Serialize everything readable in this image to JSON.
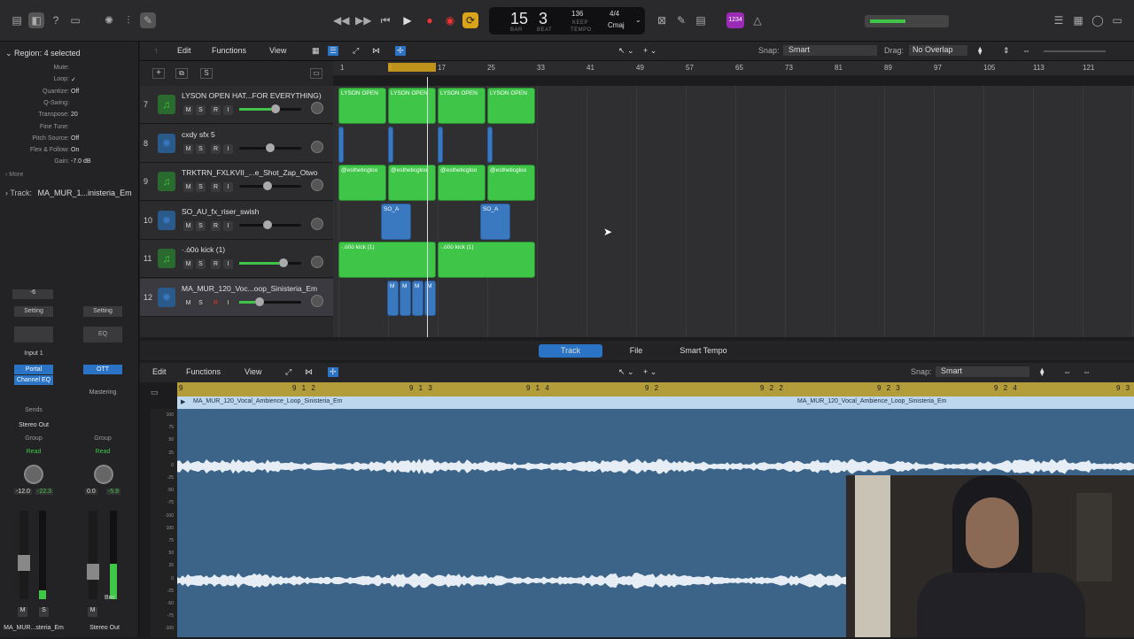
{
  "transport": {
    "bar": "15",
    "beat": "3",
    "bar_label": "BAR",
    "beat_label": "BEAT",
    "tempo": "136",
    "tempo_sub": "KEEP",
    "tempo_label": "TEMPO",
    "signature": "4/4",
    "key": "Cmaj",
    "count_in": "1234"
  },
  "inspector": {
    "region_title": "Region: 4 selected",
    "rows": [
      {
        "k": "Mute:",
        "v": ""
      },
      {
        "k": "Loop:",
        "v": "✓"
      },
      {
        "k": "Quantize:",
        "v": "Off"
      },
      {
        "k": "Q-Swing:",
        "v": ""
      },
      {
        "k": "Transpose:",
        "v": "20"
      },
      {
        "k": "Fine Tune:",
        "v": ""
      },
      {
        "k": "Pitch Source:",
        "v": "Off"
      },
      {
        "k": "Flex & Follow:",
        "v": "On"
      },
      {
        "k": "Gain:",
        "v": "-7.0 dB"
      }
    ],
    "more": "More",
    "track_label": "Track:",
    "track_name": "MA_MUR_1...inisteria_Em",
    "ch1": {
      "value": "-6",
      "setting": "Setting",
      "input": "Input 1",
      "plugin1": "Portal",
      "plugin2": "Channel EQ",
      "sends": "Sends",
      "out": "Stereo Out",
      "group": "Group",
      "read": "Read",
      "pan_l": "-12.0",
      "pan_r": "-22.3",
      "m": "M",
      "s": "S",
      "name": "MA_MUR...steria_Em"
    },
    "ch2": {
      "setting": "Setting",
      "eq": "EQ",
      "plugin1": "OTT",
      "plugin2": "Mastering",
      "group": "Group",
      "read": "Read",
      "pan_l": "0.0",
      "pan_r": "-5.9",
      "bnc": "Bnc",
      "m": "M",
      "name": "Stereo Out"
    }
  },
  "toolbar": {
    "edit": "Edit",
    "functions": "Functions",
    "view": "View",
    "snap_label": "Snap:",
    "snap": "Smart",
    "drag_label": "Drag:",
    "drag": "No Overlap"
  },
  "ruler": [
    "1",
    "9",
    "17",
    "25",
    "33",
    "41",
    "49",
    "57",
    "65",
    "73",
    "81",
    "89",
    "97",
    "105",
    "113",
    "121"
  ],
  "tracks": [
    {
      "num": "7",
      "name": "LYSON OPEN HAT...FOR EVERYTHING)",
      "color": "green"
    },
    {
      "num": "8",
      "name": "cxdy sfx 5",
      "color": "blue"
    },
    {
      "num": "9",
      "name": "TRKTRN_FXLKVII_...e_Shot_Zap_Otwo",
      "color": "green"
    },
    {
      "num": "10",
      "name": "SO_AU_fx_riser_swish",
      "color": "blue"
    },
    {
      "num": "11",
      "name": "·.ȯ0ȯ kick (1)",
      "color": "green"
    },
    {
      "num": "12",
      "name": "MA_MUR_120_Voc...oop_Sinisteria_Em",
      "color": "blue"
    }
  ],
  "track_buttons": {
    "m": "M",
    "s": "S",
    "r": "R",
    "i": "I"
  },
  "regions": {
    "hat": "LYSON OPEN",
    "zap": "@estheticgloo",
    "riser": "SO_A",
    "kick": "·.ȯ0ȯ kick (1)",
    "vocal": "M"
  },
  "editor": {
    "tabs": [
      "Track",
      "File",
      "Smart Tempo"
    ],
    "edit": "Edit",
    "functions": "Functions",
    "view": "View",
    "snap_label": "Snap:",
    "snap": "Smart",
    "ruler": [
      "9",
      "9 1 2",
      "9 1 3",
      "9 1 4",
      "9 2",
      "9 2 2",
      "9 2 3",
      "9 2 4",
      "9 3"
    ],
    "region_name": "MA_MUR_120_Vocal_Ambience_Loop_Sinisteria_Em",
    "db": [
      "100",
      "75",
      "50",
      "25",
      "0",
      "-25",
      "-50",
      "-75",
      "-100",
      "100",
      "75",
      "50",
      "25",
      "0",
      "-25",
      "-50",
      "-75",
      "-100"
    ]
  },
  "colors": {
    "green": "#3fc548",
    "blue": "#3a78c0",
    "accent": "#2b73c4",
    "ruler_gold": "#b39c3a"
  }
}
